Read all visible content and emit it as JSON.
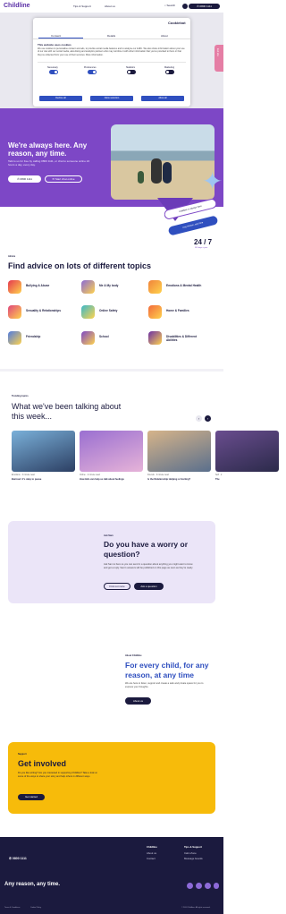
{
  "header": {
    "logo": "Childline",
    "nav": [
      "Tips & Support",
      "About us"
    ],
    "search_label": "Search",
    "phone_label": "0800 1111"
  },
  "cookie": {
    "brand": "Cookiebot",
    "tabs": [
      "Consent",
      "Details",
      "About"
    ],
    "title": "This website uses cookies",
    "text": "We use cookies to personalise content and ads, to provide social media features and to analyse our traffic. We also share information about your use of our site with our social media, advertising and analytics partners who may combine it with other information that you've provided to them or that they've collected from your use of their services. More information.",
    "toggles": [
      {
        "label": "Necessary",
        "state": "on"
      },
      {
        "label": "Preferences",
        "state": "on"
      },
      {
        "label": "Statistics",
        "state": "off"
      },
      {
        "label": "Marketing",
        "state": "off"
      }
    ],
    "buttons": [
      "Decline all",
      "Allow selection",
      "Allow all"
    ]
  },
  "side_tab": "Exit site",
  "hero": {
    "heading": "We're always here. Any reason, any time.",
    "text": "Talk to us for free by calling 0800 1111, or chat to someone online 24 hours a day, every day.",
    "btn_call": "0800 1111",
    "btn_chat": "Start chat online",
    "bubble1": "Childline is always here",
    "bubble2": "Any reason, any time",
    "hours": "24 / 7",
    "hours_sub": "365 days a year"
  },
  "advice": {
    "kicker": "Advice",
    "heading": "Find advice on lots of different topics",
    "topics": [
      {
        "label": "Bullying & Abuse",
        "color": "#e5384f"
      },
      {
        "label": "Me & My body",
        "color": "#8a6bd6"
      },
      {
        "label": "Emotions & Mental Health",
        "color": "#f0833a"
      },
      {
        "label": "Sexuality & Relationships",
        "color": "#e0457b"
      },
      {
        "label": "Online Safety",
        "color": "#3bb8c9"
      },
      {
        "label": "Home & Families",
        "color": "#f26a3b"
      },
      {
        "label": "Friendship",
        "color": "#4f7be0"
      },
      {
        "label": "School",
        "color": "#7d47c6"
      },
      {
        "label": "Disabilities & Different Abilities",
        "color": "#6b2fa6"
      }
    ]
  },
  "talked": {
    "kicker": "Trending topics",
    "heading": "What we've been talking about this week...",
    "cards": [
      {
        "meta": "Emotions  ·  3 minute read",
        "title": "Burnout: it's okay to pause",
        "c1": "#7ab0d9",
        "c2": "#2c3f63"
      },
      {
        "meta": "Online  ·  4 minute read",
        "title": "How kids can help us talk about feelings",
        "c1": "#9a6fd1",
        "c2": "#e6b3d8"
      },
      {
        "meta": "Friends  ·  3 minute read",
        "title": "Is the Relationship Helping or Hurting?",
        "c1": "#d6b48a",
        "c2": "#5a6f8c"
      },
      {
        "meta": "Self  ·  2",
        "title": "The",
        "c1": "#6a4d8f",
        "c2": "#2b2a4a"
      }
    ]
  },
  "worry": {
    "kicker": "Ask Sam",
    "heading": "Do you have a worry or question?",
    "text": "Ask Sam is here so you can send in a question about anything you might want to know and get a reply. Sam's answers will be published on this page as soon as they're ready.",
    "btn_more": "Find out more",
    "btn_ask": "Ask a question"
  },
  "about": {
    "kicker": "About Childline",
    "heading": "For every child, for any reason, at any time",
    "text": "We are here to listen, support and create a safe and private space for you to express your thoughts.",
    "btn": "About us"
  },
  "involved": {
    "kicker": "Support",
    "heading": "Get involved",
    "text": "Do you like writing? Are you interested in supporting Childline? Take a look at some of the ways to share your story and help others in different ways.",
    "btn": "Get started"
  },
  "footer": {
    "phone": "0800 1111",
    "col1_head": "Childline",
    "col1": [
      "About us",
      "Contact"
    ],
    "col2_head": "Tips & Support",
    "col2": [
      "Calm Zone",
      "Message boards"
    ],
    "tagline": "Any reason, any time.",
    "legal": [
      "Terms & Conditions",
      "Cookie Policy",
      "© 2024 Childline. All rights reserved."
    ]
  }
}
